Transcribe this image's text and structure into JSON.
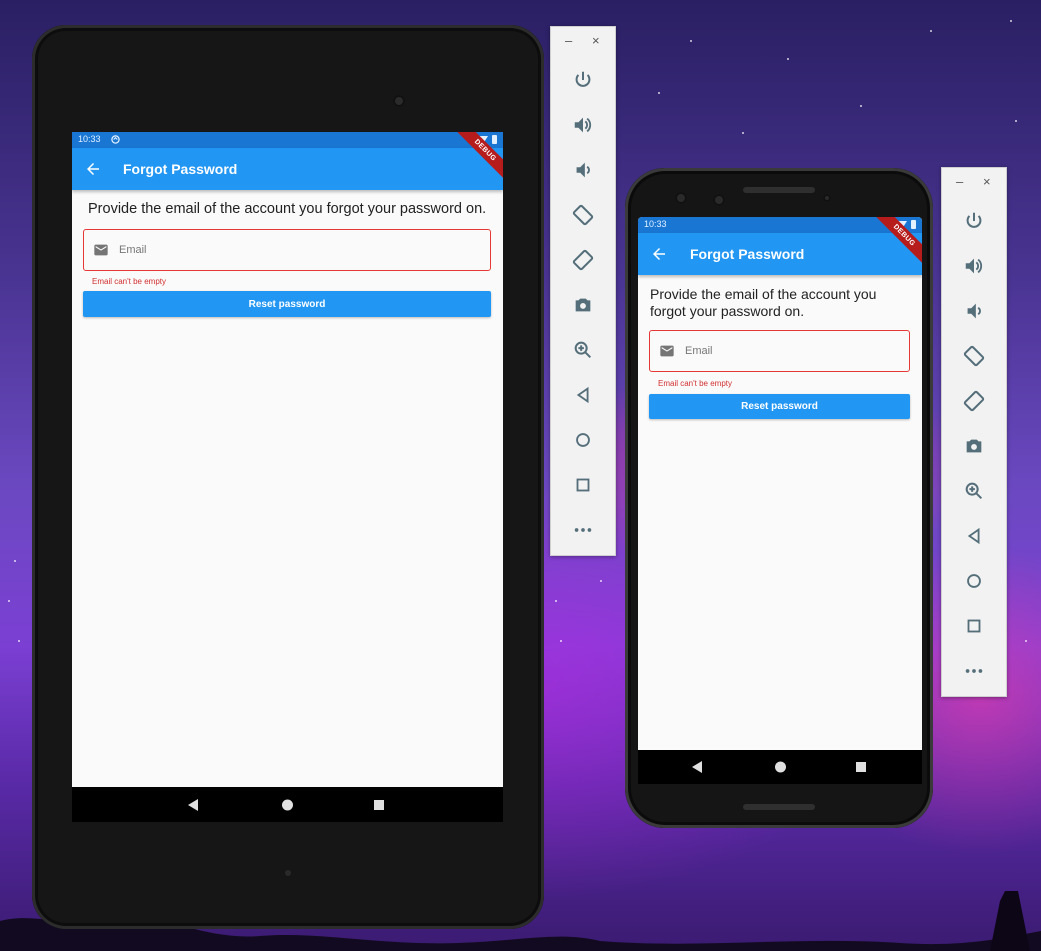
{
  "app": {
    "status_time": "10:33",
    "appbar_title": "Forgot Password",
    "debug_ribbon": "DEBUG",
    "prompt": "Provide the email of the account you forgot your password on.",
    "email_placeholder": "Email",
    "email_error": "Email can't be empty",
    "reset_button": "Reset password",
    "colors": {
      "primary": "#2196f3",
      "status_bar": "#1976d2",
      "error": "#e53935",
      "debug_ribbon": "#b71c1c"
    }
  },
  "emulator_toolbar": {
    "minimize": "–",
    "close": "×",
    "buttons": [
      {
        "icon": "power-icon"
      },
      {
        "icon": "volume-up-icon"
      },
      {
        "icon": "volume-down-icon"
      },
      {
        "icon": "rotate-left-icon"
      },
      {
        "icon": "rotate-right-icon"
      },
      {
        "icon": "camera-icon"
      },
      {
        "icon": "zoom-in-icon"
      },
      {
        "icon": "back-icon"
      },
      {
        "icon": "home-icon"
      },
      {
        "icon": "overview-icon"
      },
      {
        "icon": "more-icon"
      }
    ]
  }
}
